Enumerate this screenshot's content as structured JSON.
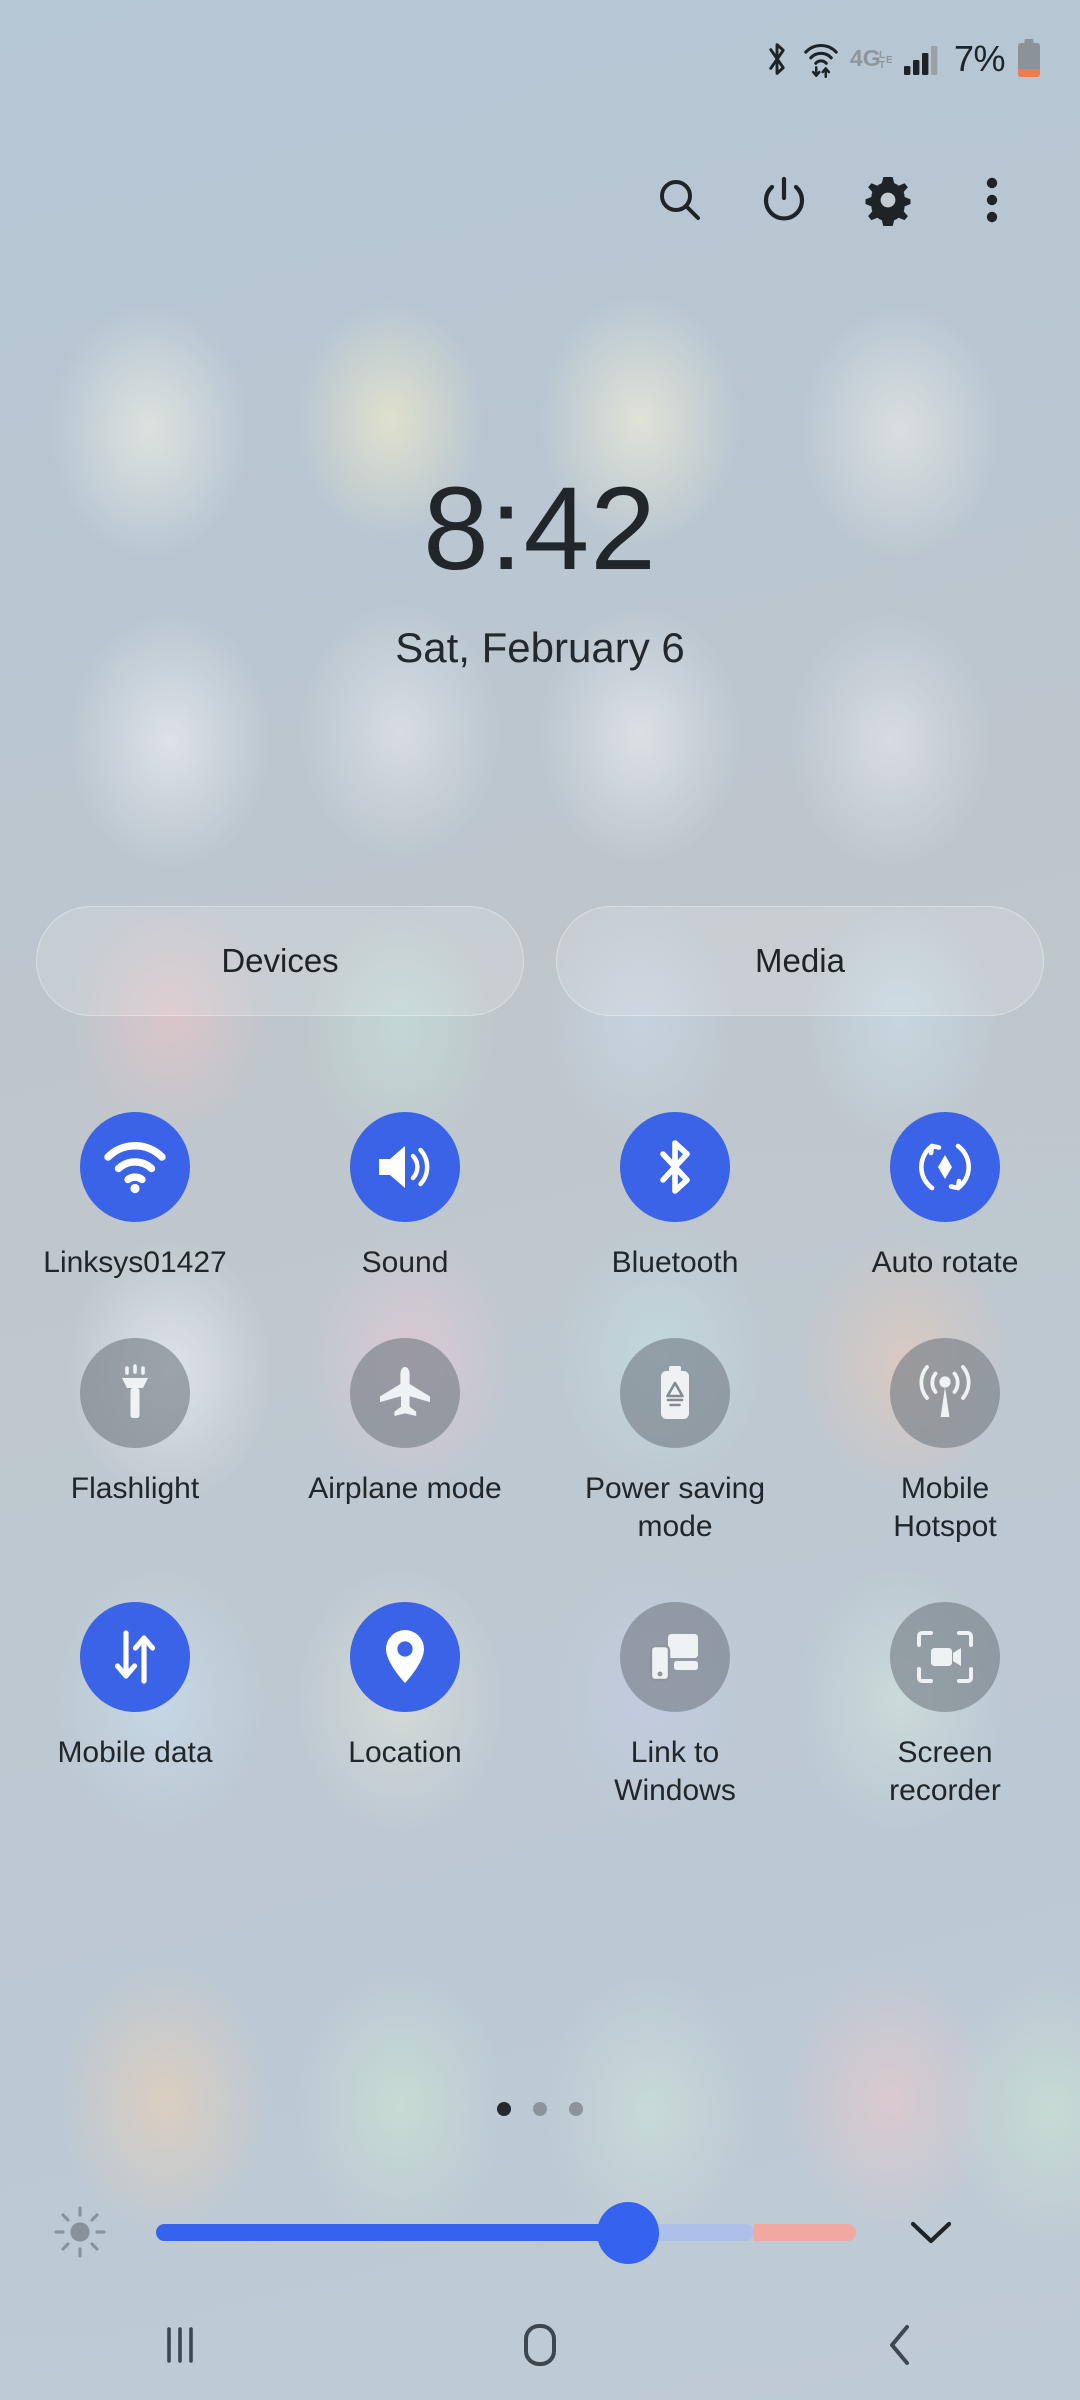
{
  "status_bar": {
    "battery_percent": "7%",
    "icons": [
      "bluetooth-icon",
      "wifi-data-icon",
      "4g-lte-icon",
      "signal-bars-icon",
      "battery-low-icon"
    ],
    "network_label": "4G",
    "network_sublabel": "LTE",
    "battery_fill_color": "#ef7b55"
  },
  "header": {
    "actions": [
      {
        "name": "search-icon",
        "label": "Search"
      },
      {
        "name": "power-icon",
        "label": "Power off"
      },
      {
        "name": "gear-icon",
        "label": "Settings"
      },
      {
        "name": "more-options-icon",
        "label": "More options"
      }
    ]
  },
  "clock": {
    "time": "8:42",
    "date": "Sat, February 6"
  },
  "pills": [
    {
      "label": "Devices",
      "name": "devices-pill"
    },
    {
      "label": "Media",
      "name": "media-pill"
    }
  ],
  "quick_settings": {
    "rows": [
      [
        {
          "label": "Linksys01427",
          "icon": "wifi-icon",
          "state": "on"
        },
        {
          "label": "Sound",
          "icon": "sound-icon",
          "state": "on"
        },
        {
          "label": "Bluetooth",
          "icon": "bluetooth-icon",
          "state": "on"
        },
        {
          "label": "Auto rotate",
          "icon": "auto-rotate-icon",
          "state": "on"
        }
      ],
      [
        {
          "label": "Flashlight",
          "icon": "flashlight-icon",
          "state": "off"
        },
        {
          "label": "Airplane mode",
          "icon": "airplane-icon",
          "state": "off"
        },
        {
          "label": "Power saving mode",
          "icon": "power-saving-icon",
          "state": "off"
        },
        {
          "label": "Mobile Hotspot",
          "icon": "hotspot-icon",
          "state": "off"
        }
      ],
      [
        {
          "label": "Mobile data",
          "icon": "mobile-data-icon",
          "state": "on"
        },
        {
          "label": "Location",
          "icon": "location-pin-icon",
          "state": "on"
        },
        {
          "label": "Link to Windows",
          "icon": "link-to-windows-icon",
          "state": "off"
        },
        {
          "label": "Screen recorder",
          "icon": "screen-recorder-icon",
          "state": "off"
        }
      ]
    ],
    "active_color": "#3a63e8",
    "inactive_color": "#747c84"
  },
  "pager": {
    "total_pages": 3,
    "active_page": 1
  },
  "brightness": {
    "value_percent": 68,
    "sun_icon": "brightness-sun-icon",
    "expand_icon": "chevron-down-icon",
    "fill_color": "#3562ee",
    "remainder_color": "#adc0ea",
    "warm_color": "#f0a8a0"
  },
  "nav_bar": {
    "buttons": [
      {
        "name": "recents-button",
        "label": "Recents"
      },
      {
        "name": "home-button",
        "label": "Home"
      },
      {
        "name": "back-button",
        "label": "Back"
      }
    ]
  }
}
